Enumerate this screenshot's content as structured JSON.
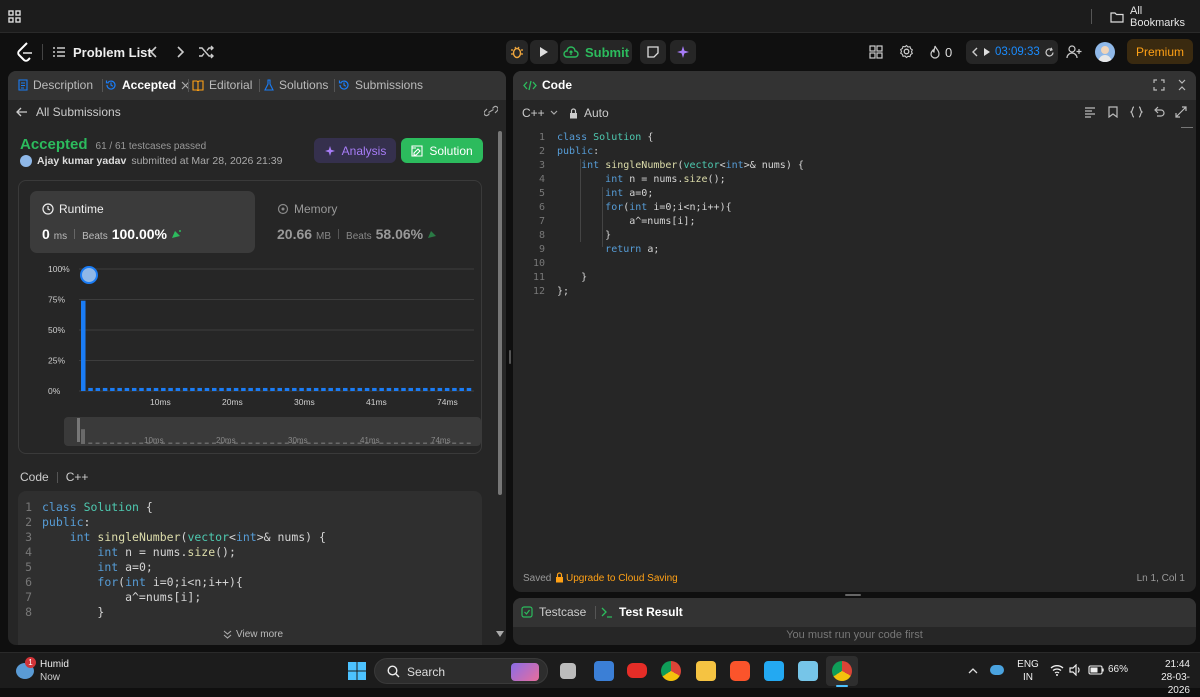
{
  "browser": {
    "bookmarks_label": "All Bookmarks"
  },
  "nav": {
    "problem_list": "Problem List",
    "submit": "Submit",
    "streak": "0",
    "timer": "03:09:33",
    "premium": "Premium"
  },
  "left_tabs": {
    "description": "Description",
    "accepted": "Accepted",
    "editorial": "Editorial",
    "solutions": "Solutions",
    "submissions": "Submissions"
  },
  "submission": {
    "back_label": "All Submissions",
    "status": "Accepted",
    "testcases": "61 / 61 testcases passed",
    "user": "Ajay kumar yadav",
    "submitted_text": "submitted at Mar 28, 2026 21:39",
    "analysis_btn": "Analysis",
    "solution_btn": "Solution"
  },
  "runtime": {
    "label": "Runtime",
    "value": "0",
    "unit": "ms",
    "beats_label": "Beats",
    "beats": "100.00%"
  },
  "memory": {
    "label": "Memory",
    "value": "20.66",
    "unit": "MB",
    "beats_label": "Beats",
    "beats": "58.06%"
  },
  "chart_data": {
    "type": "bar",
    "title": "",
    "xlabel": "",
    "ylabel": "",
    "yticks": [
      "100%",
      "75%",
      "50%",
      "25%",
      "0%"
    ],
    "xticks": [
      "10ms",
      "20ms",
      "30ms",
      "41ms",
      "74ms"
    ],
    "ylim": [
      0,
      100
    ],
    "values": [
      74,
      2.5,
      2.5,
      2.5,
      2.5,
      2.5,
      2.5,
      2.5,
      2.5,
      2.5,
      2.5,
      2.5,
      2.5,
      2.5,
      2.5,
      2.5,
      2.5,
      2.5,
      2.5,
      2.5,
      2.5,
      2.5,
      2.5,
      2.5,
      2.5,
      2.5,
      2.5,
      2.5,
      2.5,
      2.5,
      2.5,
      2.5,
      2.5,
      2.5,
      2.5,
      2.5,
      2.5,
      2.5,
      2.5,
      2.5,
      2.5,
      2.5,
      2.5,
      2.5,
      2.5,
      2.5,
      2.5,
      2.5,
      2.5,
      2.5,
      2.5,
      2.5,
      2.5,
      2.5
    ],
    "grid": true,
    "bar_color": "#1a7cf5"
  },
  "code_section": {
    "label": "Code",
    "lang": "C++",
    "view_more": "View more"
  },
  "code_preview": [
    {
      "n": "1",
      "t": "class Solution {"
    },
    {
      "n": "2",
      "t": "public:"
    },
    {
      "n": "3",
      "t": "    int singleNumber(vector<int>& nums) {"
    },
    {
      "n": "4",
      "t": "        int n = nums.size();"
    },
    {
      "n": "5",
      "t": "        int a=0;"
    },
    {
      "n": "6",
      "t": "        for(int i=0;i<n;i++){"
    },
    {
      "n": "7",
      "t": "            a^=nums[i];"
    },
    {
      "n": "8",
      "t": "        }"
    }
  ],
  "editor": {
    "title": "Code",
    "lang": "C++",
    "mode": "Auto",
    "saved": "Saved",
    "upgrade": "Upgrade to Cloud Saving",
    "cursor": "Ln 1, Col 1",
    "lines": [
      {
        "n": "1",
        "t": "class Solution {"
      },
      {
        "n": "2",
        "t": "public:"
      },
      {
        "n": "3",
        "t": "    int singleNumber(vector<int>& nums) {"
      },
      {
        "n": "4",
        "t": "        int n = nums.size();"
      },
      {
        "n": "5",
        "t": "        int a=0;"
      },
      {
        "n": "6",
        "t": "        for(int i=0;i<n;i++){"
      },
      {
        "n": "7",
        "t": "            a^=nums[i];"
      },
      {
        "n": "8",
        "t": "        }"
      },
      {
        "n": "9",
        "t": "        return a;"
      },
      {
        "n": "10",
        "t": ""
      },
      {
        "n": "11",
        "t": "    }"
      },
      {
        "n": "12",
        "t": "};"
      }
    ]
  },
  "bottom": {
    "testcase": "Testcase",
    "test_result": "Test Result",
    "hint": "You must run your code first"
  },
  "taskbar": {
    "weather_title": "Humid",
    "weather_sub": "Now",
    "weather_badge": "1",
    "search": "Search",
    "lang1": "ENG",
    "lang2": "IN",
    "battery": "66%",
    "time": "21:44",
    "date": "28-03-2026"
  }
}
